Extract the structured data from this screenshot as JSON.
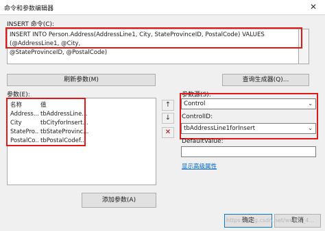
{
  "window": {
    "title": "命令和参数编辑器",
    "close_glyph": "✕"
  },
  "command": {
    "label": "INSERT 命令(C):",
    "line1": "INSERT INTO Person.Address(AddressLine1, City, StateProvinceID, PostalCode) VALUES (@AddressLine1, @City,",
    "line2": "@StateProvinceID, @PostalCode)"
  },
  "buttons": {
    "refresh": "刷新参数(M)",
    "query_builder": "查询生成器(Q)...",
    "add_param": "添加参数(A)",
    "ok": "确定",
    "cancel": "取消"
  },
  "params": {
    "label": "参数(E):",
    "headers": [
      "名称",
      "值"
    ],
    "rows": [
      [
        "Address...",
        "tbAddressLine..."
      ],
      [
        "City",
        "tbCityforInsert..."
      ],
      [
        "StatePro...",
        "tbStateProvinc..."
      ],
      [
        "PostalCo...",
        "tbPostalCodef..."
      ]
    ]
  },
  "side_buttons": {
    "up": "↑",
    "down": "↓",
    "delete": "✕"
  },
  "source": {
    "label": "参数源(S):",
    "value": "Control",
    "arrow": "⌄"
  },
  "control": {
    "label": "ControlID:",
    "value": "tbAddressLine1forInsert",
    "arrow": "⌄"
  },
  "default_value": {
    "label": "DefaultValue:",
    "value": ""
  },
  "advanced_link": "显示高级属性",
  "watermark": "https://blog.csdn.net/weixin_4..."
}
